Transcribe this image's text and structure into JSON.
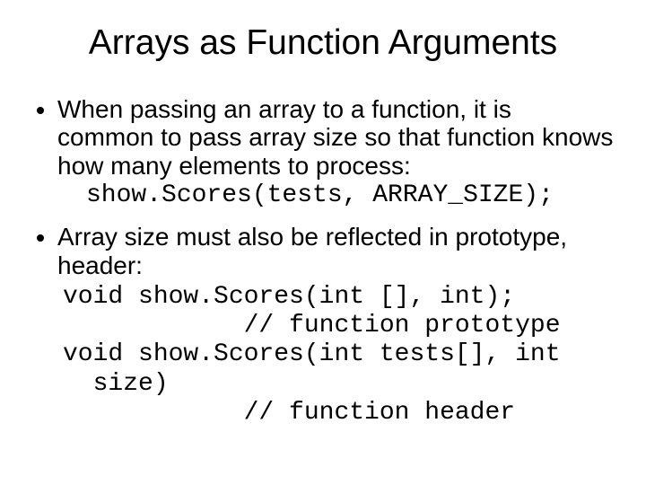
{
  "title": "Arrays as Function Arguments",
  "bullet1": "When passing an array to a function, it is common to pass array size so that function knows how many elements to process:",
  "code1": "show.Scores(tests, ARRAY_SIZE);",
  "bullet2": "Array size must also be reflected in prototype, header:",
  "code2": "void show.Scores(int [], int);\n            // function prototype\nvoid show.Scores(int tests[], int\n  size)\n            // function header"
}
